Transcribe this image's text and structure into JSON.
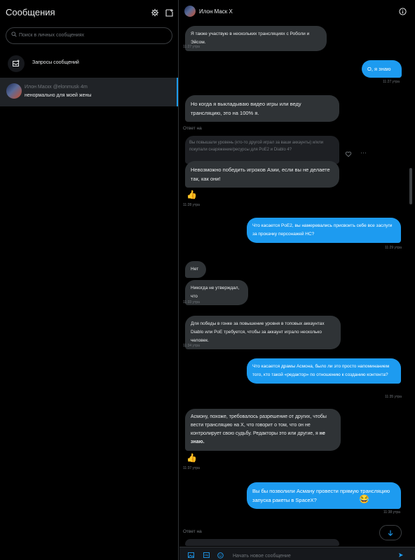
{
  "sidebar": {
    "title": "Сообщения",
    "search_placeholder": "Поиск в личных сообщениях",
    "requests_label": "Запросы сообщений",
    "conversation": {
      "name": "Илон Маскх @elonmusk·4m",
      "preview": "ненормально для моей жены"
    }
  },
  "chat": {
    "title": "Илон Маск X",
    "messages": [
      {
        "text": "Я также участвую в нескольких трансляциях с Роболи и Эйсом.",
        "time": "11:27 утра"
      },
      {
        "text": "О, я знаю",
        "time": "11:27 утра"
      },
      {
        "text": "Но когда я выкладываю видео игры или веду трансляцию, это на 100% я."
      },
      {
        "reply_label": "Ответ на"
      },
      {
        "quote": "Вы повышали уровень (кто-то другой играл за ваши аккаунты) и/или покупали снаряжение/ресурсы для PoE2 и Diablo 4?"
      },
      {
        "text": "Невозможно победить игроков Азии, если вы не делаете так, как они!",
        "reaction": "👍",
        "time": "11:28 утра"
      },
      {
        "text": "Что касается PoE2, вы намеревались присвоить себе все заслуги за прокачку персонажей HC?",
        "time": "11:29 утра"
      },
      {
        "text": "Нет"
      },
      {
        "text": "Никогда не утверждал, что",
        "time": "11:33 утра"
      },
      {
        "text": "Для победы в гонке за повышение уровня в топовых аккаунтах Diablo или PoE требуется, чтобы за аккаунт играло несколько человек.",
        "time": "11:34 утра"
      },
      {
        "text": "Что касается драмы Асмона, было ли это просто напоминанием того, кто такой «редактор» по отношению к созданию контента?",
        "time": "11:35 утра"
      },
      {
        "text_a": "Асмону, похоже, требовалось разрешение от других, чтобы вести трансляцию на X, что говорит о том, что он не контролирует свою судьбу. Редакторы это или другие, я",
        "text_b": "не знаю.",
        "reaction": "👍",
        "time": "11:37 утра"
      },
      {
        "text": "Вы бы позволили Асману провести прямую трансляцию запуска ракеты в SpaceX?",
        "reaction": "😂",
        "time": "11:38 утра"
      },
      {
        "reply_label": "Ответ на"
      }
    ],
    "composer_placeholder": "Начать новое сообщение"
  },
  "colors": {
    "accent": "#1d9bf0",
    "incoming_bubble": "#2f3336",
    "background": "#000000"
  }
}
